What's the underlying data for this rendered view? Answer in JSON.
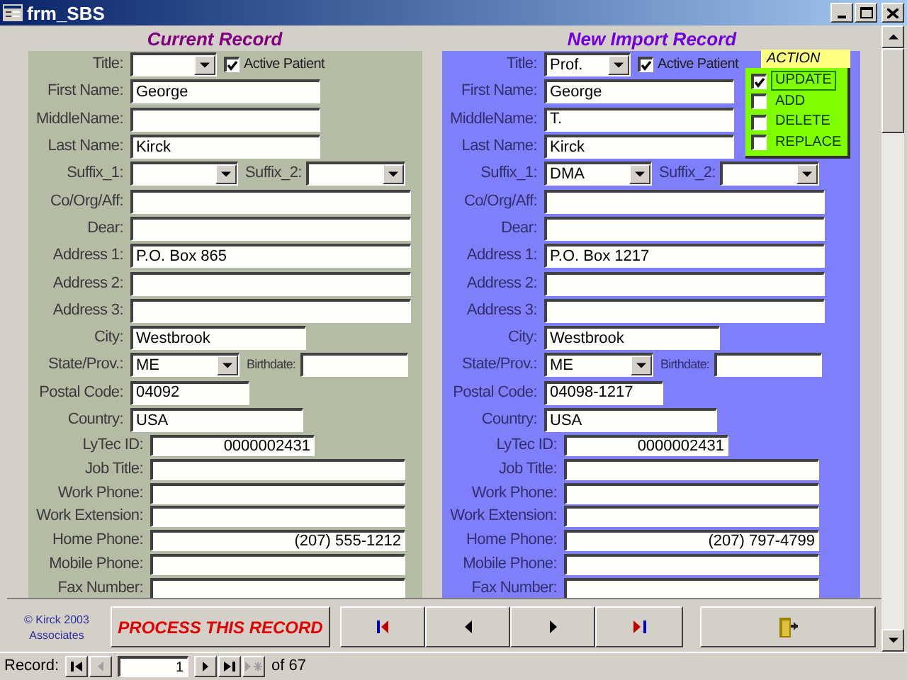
{
  "window": {
    "title": "frm_SBS"
  },
  "panels": [
    {
      "heading": "Current Record",
      "rows": [
        {
          "label": "Title:",
          "kind": "select",
          "extra": {
            "kind": "checkbox",
            "label": "Active Patient",
            "checked": true
          }
        },
        {
          "label": "First Name:",
          "kind": "text",
          "value": "George"
        },
        {
          "label": "MiddleName:",
          "kind": "text"
        },
        {
          "label": "Last Name:",
          "kind": "text",
          "value": "Kirck"
        },
        {
          "label": "Suffix_1:",
          "kind": "select",
          "extra": {
            "kind": "select",
            "label": "Suffix_2:"
          }
        },
        {
          "label": "Co/Org/Aff:",
          "kind": "text"
        },
        {
          "label": "Dear:",
          "kind": "text"
        },
        {
          "label": "Address 1:",
          "kind": "text",
          "value": "P.O. Box 865"
        },
        {
          "label": "Address 2:",
          "kind": "text"
        },
        {
          "label": "Address 3:",
          "kind": "text"
        },
        {
          "label": "City:",
          "kind": "text",
          "value": "Westbrook"
        },
        {
          "label": "State/Prov.:",
          "kind": "select",
          "value": "ME",
          "extra": {
            "kind": "text",
            "label": "Birthdate:"
          }
        },
        {
          "label": "Postal Code:",
          "kind": "text",
          "value": "04092"
        },
        {
          "label": "Country:",
          "kind": "text",
          "value": "USA"
        },
        {
          "label": "LyTec ID:",
          "kind": "number",
          "value": "0000002431"
        },
        {
          "label": "Job Title:",
          "kind": "text"
        },
        {
          "label": "Work Phone:",
          "kind": "text"
        },
        {
          "label": "Work Extension:",
          "kind": "text"
        },
        {
          "label": "Home Phone:",
          "kind": "number",
          "value": "(207) 555-1212"
        },
        {
          "label": "Mobile Phone:",
          "kind": "text"
        },
        {
          "label": "Fax Number:",
          "kind": "text"
        }
      ]
    },
    {
      "heading": "New Import Record",
      "rows": [
        {
          "label": "Title:",
          "kind": "select",
          "value": "Prof.",
          "extra": {
            "kind": "checkbox",
            "label": "Active Patient",
            "checked": true
          }
        },
        {
          "label": "First Name:",
          "kind": "text",
          "value": "George"
        },
        {
          "label": "MiddleName:",
          "kind": "text",
          "value": "T."
        },
        {
          "label": "Last Name:",
          "kind": "text",
          "value": "Kirck"
        },
        {
          "label": "Suffix_1:",
          "kind": "select",
          "value": "DMA",
          "extra": {
            "kind": "select",
            "label": "Suffix_2:"
          }
        },
        {
          "label": "Co/Org/Aff:",
          "kind": "text"
        },
        {
          "label": "Dear:",
          "kind": "text"
        },
        {
          "label": "Address 1:",
          "kind": "text",
          "value": "P.O. Box 1217"
        },
        {
          "label": "Address 2:",
          "kind": "text"
        },
        {
          "label": "Address 3:",
          "kind": "text"
        },
        {
          "label": "City:",
          "kind": "text",
          "value": "Westbrook"
        },
        {
          "label": "State/Prov.:",
          "kind": "select",
          "value": "ME",
          "extra": {
            "kind": "text",
            "label": "Birthdate:"
          }
        },
        {
          "label": "Postal Code:",
          "kind": "text",
          "value": "04098-1217"
        },
        {
          "label": "Country:",
          "kind": "text",
          "value": "USA"
        },
        {
          "label": "LyTec ID:",
          "kind": "number",
          "value": "0000002431"
        },
        {
          "label": "Job Title:",
          "kind": "text"
        },
        {
          "label": "Work Phone:",
          "kind": "text"
        },
        {
          "label": "Work Extension:",
          "kind": "text"
        },
        {
          "label": "Home Phone:",
          "kind": "number",
          "value": "(207) 797-4799"
        },
        {
          "label": "Mobile Phone:",
          "kind": "text"
        },
        {
          "label": "Fax Number:",
          "kind": "text"
        }
      ]
    }
  ],
  "action": {
    "heading": "ACTION",
    "options": [
      {
        "label": "UPDATE",
        "checked": true,
        "focused": true
      },
      {
        "label": "ADD",
        "checked": false,
        "focused": false
      },
      {
        "label": "DELETE",
        "checked": false,
        "focused": false
      },
      {
        "label": "REPLACE",
        "checked": false,
        "focused": false
      }
    ]
  },
  "footer": {
    "copyright": "© Kirck 2003 Associates",
    "process_button": "PROCESS THIS RECORD",
    "nav_buttons": [
      {
        "kind": "first"
      },
      {
        "kind": "prev"
      },
      {
        "kind": "next"
      },
      {
        "kind": "last"
      },
      {
        "kind": "exit"
      }
    ]
  },
  "record_bar": {
    "label": "Record:",
    "current": "1",
    "total": "of 67",
    "buttons": [
      {
        "kind": "first",
        "disabled": false
      },
      {
        "kind": "prev",
        "disabled": true
      },
      {
        "kind": "next",
        "disabled": false
      },
      {
        "kind": "last",
        "disabled": false
      },
      {
        "kind": "new",
        "disabled": true
      }
    ]
  }
}
